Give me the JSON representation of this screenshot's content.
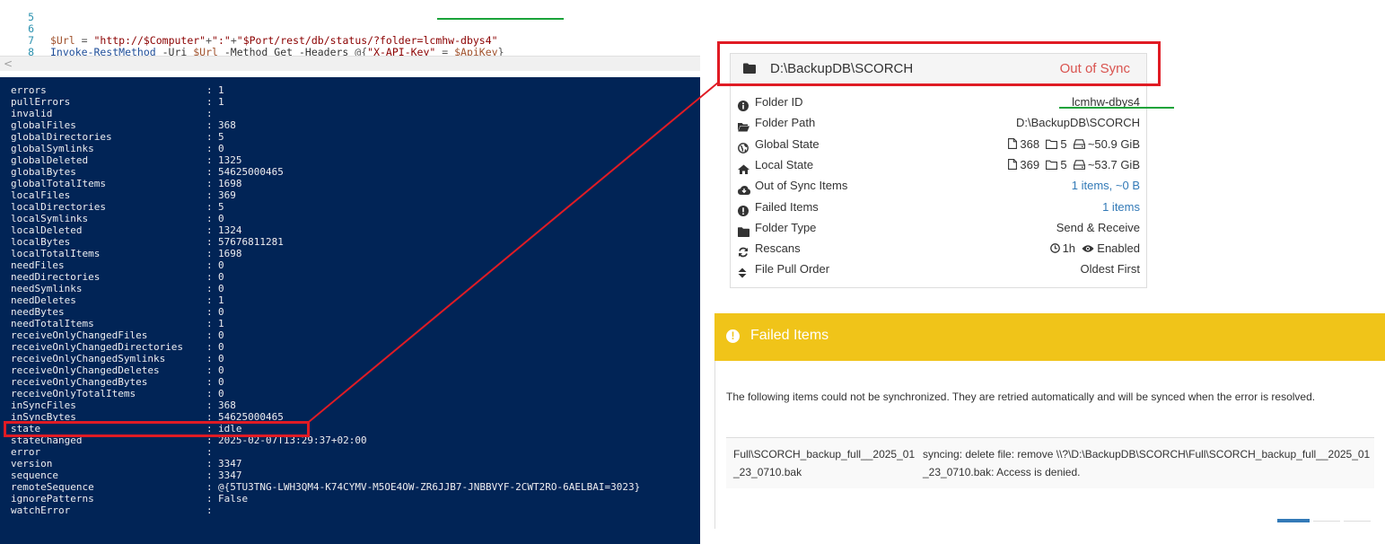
{
  "editor": {
    "lines": [
      {
        "num": "5"
      },
      {
        "num": "6",
        "var1": "$Url",
        "eq": " = ",
        "s1": "\"http://$Computer\"",
        "p1": "+",
        "s2": "\":\"",
        "p2": "+",
        "s3": "\"$Port/rest/db/status/?folder=lcmhw-dbys4\""
      },
      {
        "num": "7",
        "cmd": "Invoke-RestMethod",
        "a1": " -Uri ",
        "v1": "$Url",
        "a2": " -Method ",
        "a3": "Get",
        "a4": " -Headers ",
        "a5": "@{",
        "s": "\"X-API-Key\"",
        "a6": " = ",
        "v2": "$ApiKey",
        "a7": "}"
      },
      {
        "num": "8"
      }
    ],
    "scroll_left": "<"
  },
  "console": {
    "rows": [
      {
        "key": "errors",
        "value": "1"
      },
      {
        "key": "pullErrors",
        "value": "1"
      },
      {
        "key": "invalid",
        "value": ""
      },
      {
        "key": "globalFiles",
        "value": "368"
      },
      {
        "key": "globalDirectories",
        "value": "5"
      },
      {
        "key": "globalSymlinks",
        "value": "0"
      },
      {
        "key": "globalDeleted",
        "value": "1325"
      },
      {
        "key": "globalBytes",
        "value": "54625000465"
      },
      {
        "key": "globalTotalItems",
        "value": "1698"
      },
      {
        "key": "localFiles",
        "value": "369"
      },
      {
        "key": "localDirectories",
        "value": "5"
      },
      {
        "key": "localSymlinks",
        "value": "0"
      },
      {
        "key": "localDeleted",
        "value": "1324"
      },
      {
        "key": "localBytes",
        "value": "57676811281"
      },
      {
        "key": "localTotalItems",
        "value": "1698"
      },
      {
        "key": "needFiles",
        "value": "0"
      },
      {
        "key": "needDirectories",
        "value": "0"
      },
      {
        "key": "needSymlinks",
        "value": "0"
      },
      {
        "key": "needDeletes",
        "value": "1"
      },
      {
        "key": "needBytes",
        "value": "0"
      },
      {
        "key": "needTotalItems",
        "value": "1"
      },
      {
        "key": "receiveOnlyChangedFiles",
        "value": "0"
      },
      {
        "key": "receiveOnlyChangedDirectories",
        "value": "0"
      },
      {
        "key": "receiveOnlyChangedSymlinks",
        "value": "0"
      },
      {
        "key": "receiveOnlyChangedDeletes",
        "value": "0"
      },
      {
        "key": "receiveOnlyChangedBytes",
        "value": "0"
      },
      {
        "key": "receiveOnlyTotalItems",
        "value": "0"
      },
      {
        "key": "inSyncFiles",
        "value": "368"
      },
      {
        "key": "inSyncBytes",
        "value": "54625000465"
      },
      {
        "key": "state",
        "value": "idle"
      },
      {
        "key": "stateChanged",
        "value": "2025-02-07T13:29:37+02:00"
      },
      {
        "key": "error",
        "value": ""
      },
      {
        "key": "version",
        "value": "3347"
      },
      {
        "key": "sequence",
        "value": "3347"
      },
      {
        "key": "remoteSequence",
        "value": "@{5TU3TNG-LWH3QM4-K74CYMV-M5OE4OW-ZR6JJB7-JNBBVYF-2CWT2RO-6AELBAI=3023}"
      },
      {
        "key": "ignorePatterns",
        "value": "False"
      },
      {
        "key": "watchError",
        "value": ""
      }
    ]
  },
  "folder": {
    "path_title": "D:\\BackupDB\\SCORCH",
    "status": "Out of Sync",
    "rows": [
      {
        "icon": "info-icon",
        "label": "Folder ID",
        "value": "lcmhw-dbys4"
      },
      {
        "icon": "folder-open-icon",
        "label": "Folder Path",
        "value": "D:\\BackupDB\\SCORCH"
      },
      {
        "icon": "globe-icon",
        "label": "Global State",
        "files": "368",
        "dirs": "5",
        "size": "~50.9 GiB"
      },
      {
        "icon": "home-icon",
        "label": "Local State",
        "files": "369",
        "dirs": "5",
        "size": "~53.7 GiB"
      },
      {
        "icon": "cloud-download-icon",
        "label": "Out of Sync Items",
        "value": "1 items, ~0 B"
      },
      {
        "icon": "exclamation-circle-icon",
        "label": "Failed Items",
        "value": "1 items"
      },
      {
        "icon": "folder-icon",
        "label": "Folder Type",
        "value": "Send & Receive"
      },
      {
        "icon": "refresh-icon",
        "label": "Rescans",
        "interval": "1h",
        "watch": "Enabled"
      },
      {
        "icon": "sort-icon",
        "label": "File Pull Order",
        "value": "Oldest First"
      }
    ]
  },
  "failed": {
    "title": "Failed Items",
    "description": "The following items could not be synchronized. They are retried automatically and will be synced when the error is resolved.",
    "file": "Full\\SCORCH_backup_full__2025_01_23_0710.bak",
    "message": "syncing: delete file: remove \\\\?\\D:\\BackupDB\\SCORCH\\Full\\SCORCH_backup_full__2025_01_23_0710.bak: Access is denied."
  },
  "colors": {
    "console_bg": "#012456",
    "annotation_red": "#e01b24",
    "annotation_green": "#1aa33a",
    "warning_yellow": "#f0c419",
    "out_of_sync_red": "#d9534f",
    "link_blue": "#337ab7"
  }
}
